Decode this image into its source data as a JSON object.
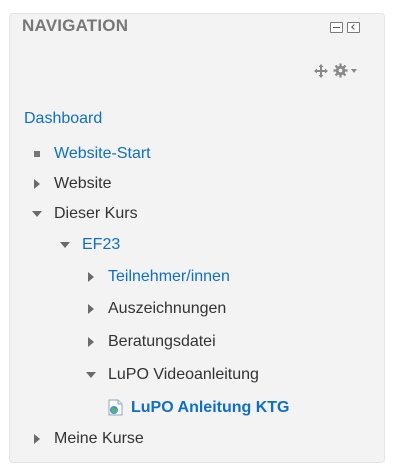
{
  "block": {
    "title": "NAVIGATION"
  },
  "controls": {
    "minimize_icon": "minus-icon",
    "dock_icon": "dock-icon",
    "move_icon": "move-icon",
    "actions_icon": "gear-icon"
  },
  "nav": {
    "dashboard": "Dashboard",
    "website_start": "Website-Start",
    "website": "Website",
    "dieser_kurs": "Dieser Kurs",
    "ef23": "EF23",
    "teilnehmer": "Teilnehmer/innen",
    "auszeichnungen": "Auszeichnungen",
    "beratungsdatei": "Beratungsdatei",
    "lupo_video": "LuPO Videoanleitung",
    "lupo_anleitung": "LuPO Anleitung KTG",
    "meine_kurse": "Meine Kurse"
  },
  "colors": {
    "link": "#0f6fc5",
    "text": "#333333",
    "title": "#777777",
    "background": "#f3f3f3"
  }
}
